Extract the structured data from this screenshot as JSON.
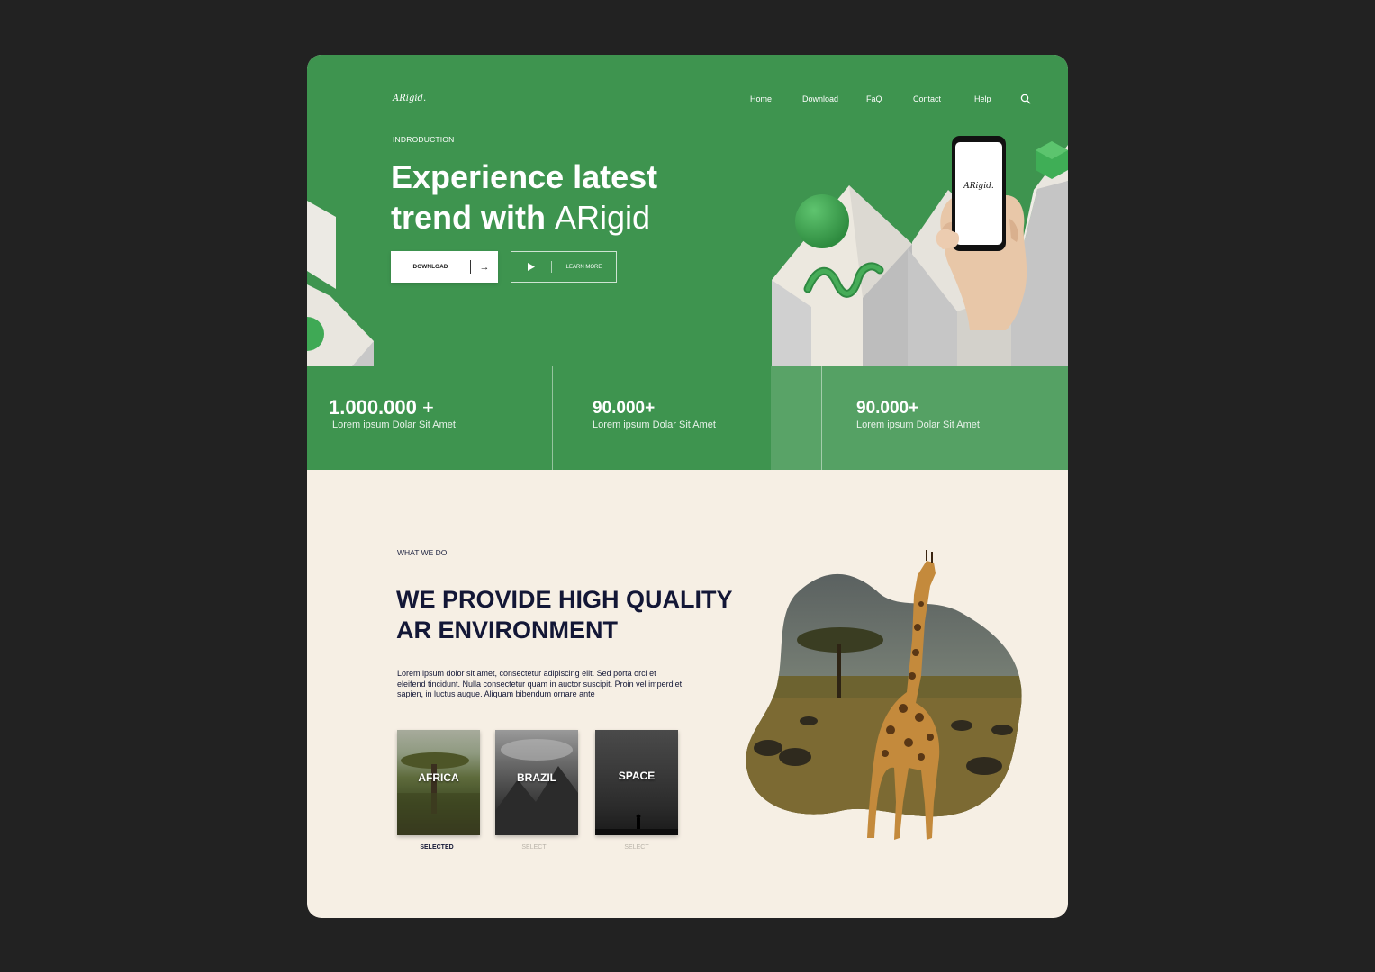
{
  "brand": {
    "logo": "ARigid."
  },
  "nav": {
    "items": [
      "Home",
      "Download",
      "FaQ",
      "Contact",
      "Help"
    ]
  },
  "hero": {
    "eyebrow": "INDRODUCTION",
    "headline_line1": "Experience latest",
    "headline_line2_bold": "trend with ",
    "headline_line2_light": "ARigid",
    "download_label": "DOWNLOAD",
    "learn_label": "LEARN MORE",
    "phone_logo": "ARigid."
  },
  "stats": [
    {
      "value": "1.000.000",
      "suffix": "+",
      "label": "Lorem ipsum Dolar Sit Amet"
    },
    {
      "value": "90.000+",
      "suffix": "",
      "label": "Lorem ipsum Dolar Sit Amet"
    },
    {
      "value": "90.000+",
      "suffix": "",
      "label": "Lorem ipsum Dolar Sit Amet"
    }
  ],
  "section": {
    "eyebrow": "WHAT WE DO",
    "title_line1": "WE PROVIDE HIGH QUALITY",
    "title_line2": "AR ENVIRONMENT",
    "body": "Lorem ipsum dolor sit amet, consectetur adipiscing elit. Sed porta orci et eleifend tincidunt. Nulla consectetur quam in auctor suscipit. Proin vel imperdiet sapien, in luctus augue. Aliquam bibendum ornare ante"
  },
  "environments": [
    {
      "name": "AFRICA",
      "caption": "SELECTED",
      "selected": true
    },
    {
      "name": "BRAZIL",
      "caption": "SELECT",
      "selected": false
    },
    {
      "name": "SPACE",
      "caption": "SELECT",
      "selected": false
    }
  ],
  "colors": {
    "primary_green": "#3e944f",
    "cream": "#f6efe4",
    "navy": "#131736",
    "frame": "#222222"
  },
  "icons": [
    "search-icon",
    "arrow-right-icon",
    "play-icon"
  ]
}
